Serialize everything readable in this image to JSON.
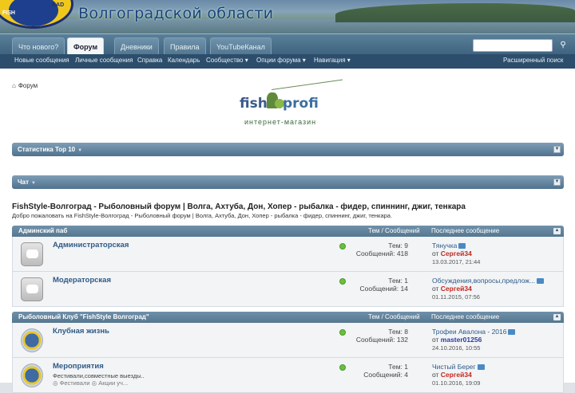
{
  "header": {
    "site_title": "Волгоградской области",
    "logo_text": "FISH",
    "logo_text2": "RAD"
  },
  "nav": {
    "tabs": [
      {
        "label": "Что нового?"
      },
      {
        "label": "Форум"
      },
      {
        "label": "Дневники"
      },
      {
        "label": "Правила"
      },
      {
        "label": "YouTubeКанал"
      }
    ],
    "search_icon": "search-icon",
    "sub_items": [
      {
        "label": "Новые сообщения"
      },
      {
        "label": "Личные сообщения"
      },
      {
        "label": "Справка"
      },
      {
        "label": "Календарь"
      },
      {
        "label": "Сообщество ▾"
      },
      {
        "label": "Опции форума ▾"
      },
      {
        "label": "Навигация ▾"
      }
    ],
    "advanced_search": "Расширенный поиск"
  },
  "breadcrumb": {
    "label": "Форум"
  },
  "ad": {
    "brand1": "fish",
    "brand2": "profi",
    "tagline": "интернет-магазин"
  },
  "blocks": {
    "stats": "Статистика Top 10",
    "chat": "Чат"
  },
  "forum": {
    "title": "FishStyle-Волгоград - Рыболовный форум | Волга, Ахтуба, Дон, Хопер - рыбалка - фидер, спиннинг, джиг, тенкара",
    "description": "Добро пожаловать на FishStyle-Волгоград - Рыболовный форум | Волга, Ахтуба, Дон, Хопер - рыбалка - фидер, спиннинг, джиг, тенкара."
  },
  "sections": [
    {
      "name": "Админский паб",
      "col_topics": "Тем / Сообщений",
      "col_last": "Последнее сообщение",
      "rows": [
        {
          "title": "Администраторская",
          "desc": "",
          "desc2": "",
          "topics": "Тем: 9",
          "posts": "Сообщений: 418",
          "last": "Тянучка",
          "by_prefix": "от ",
          "by": "Сергей34",
          "date": "13.03.2017, 21:44"
        },
        {
          "title": "Модераторская",
          "desc": "",
          "desc2": "",
          "topics": "Тем: 1",
          "posts": "Сообщений: 14",
          "last": "Обсуждения,вопросы,предлож...",
          "by_prefix": "от ",
          "by": "Сергей34",
          "date": "01.11.2015, 07:56"
        }
      ]
    },
    {
      "name": "Рыболовный Клуб \"FishStyle Волгоград\"",
      "col_topics": "Тем / Сообщений",
      "col_last": "Последнее сообщение",
      "rows": [
        {
          "title": "Клубная жизнь",
          "desc": "",
          "desc2": "",
          "topics": "Тем: 8",
          "posts": "Сообщений: 132",
          "last": "Трофеи Авалона - 2016",
          "by_prefix": "от ",
          "by": "master01256",
          "date": "24.10.2016, 10:55"
        },
        {
          "title": "Мероприятия",
          "desc": "Фестивали,совместные выезды..",
          "desc2": "◎ Фестивали  ◎ Акции уч...",
          "topics": "Тем: 1",
          "posts": "Сообщений: 4",
          "last": "Чистый Берег",
          "by_prefix": "от ",
          "by": "Сергей34",
          "date": "01.10.2016, 19:09"
        }
      ]
    }
  ]
}
